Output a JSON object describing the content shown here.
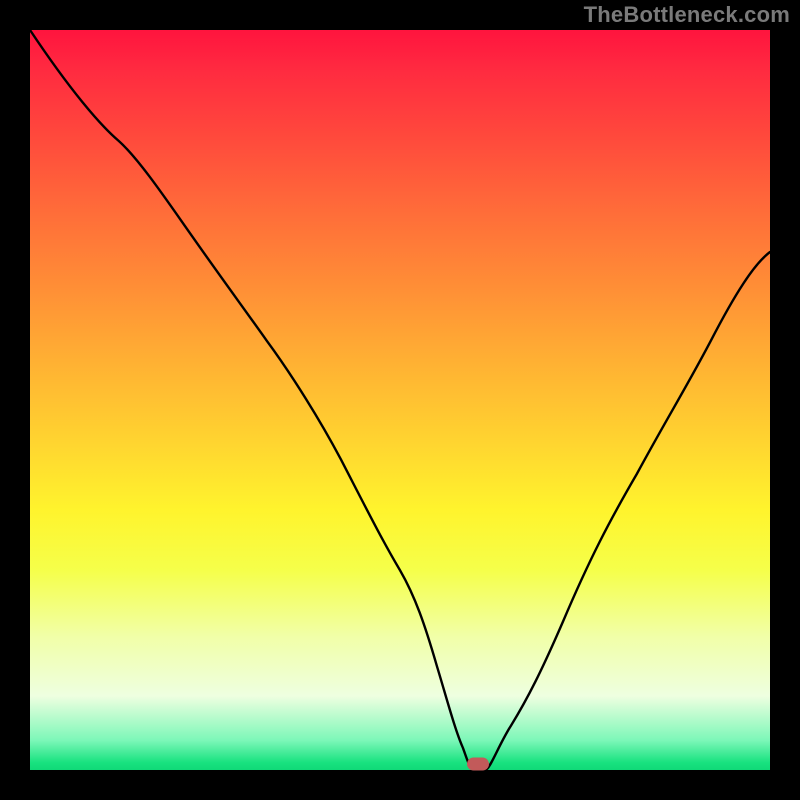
{
  "watermark": "TheBottleneck.com",
  "chart_data": {
    "type": "line",
    "title": "",
    "xlabel": "",
    "ylabel": "",
    "ylim": [
      0,
      100
    ],
    "xlim": [
      0,
      100
    ],
    "series": [
      {
        "name": "bottleneck-curve",
        "x": [
          0,
          12,
          22,
          32,
          42,
          50,
          55,
          58.5,
          60,
          61.5,
          65,
          72,
          82,
          92,
          100
        ],
        "values": [
          100,
          85,
          72,
          58,
          42,
          27,
          14,
          3,
          0,
          0,
          6,
          20,
          40,
          58,
          70
        ]
      }
    ],
    "marker": {
      "x": 60.5,
      "y": 0
    }
  },
  "colors": {
    "background": "#000000",
    "curve": "#000000",
    "marker": "#c25a5a"
  }
}
